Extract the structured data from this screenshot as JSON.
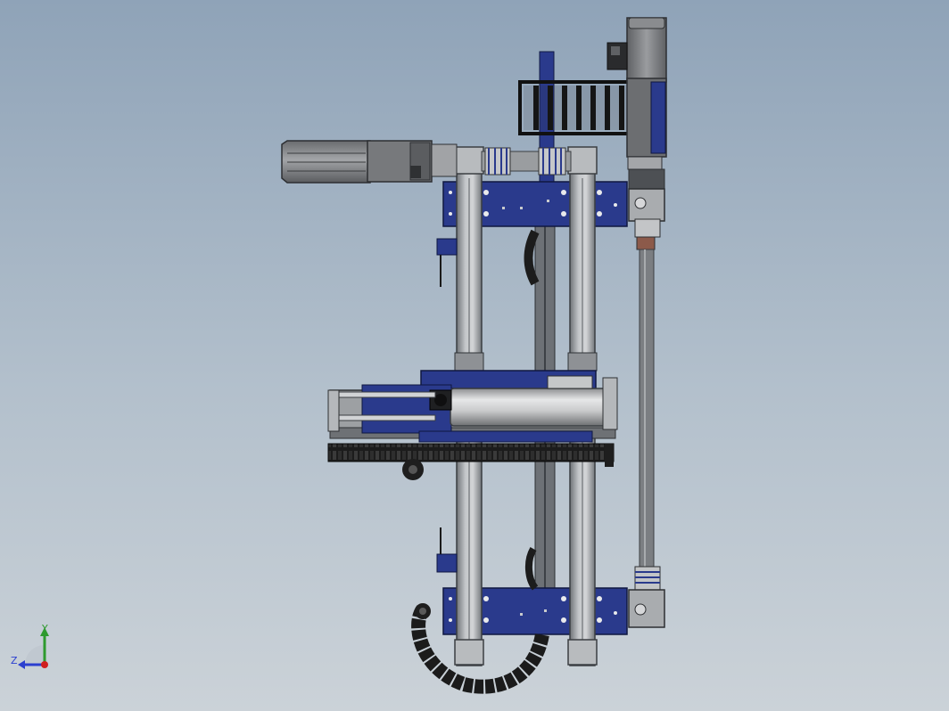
{
  "viewport": {
    "background_top": "#8fa3b8",
    "background_bottom": "#cbd2d8"
  },
  "triad": {
    "y_label": "Y",
    "z_label": "Z",
    "y_color": "#2e9a2e",
    "z_color": "#2b3fcf",
    "x_color": "#d01f1f"
  },
  "model": {
    "frame_color": "#2a3a8c",
    "rail_color": "#a9adb1",
    "chain_color": "#1e1e1e",
    "motor_color": "#7e8083",
    "cylinder_color": "#c8c9ca"
  }
}
